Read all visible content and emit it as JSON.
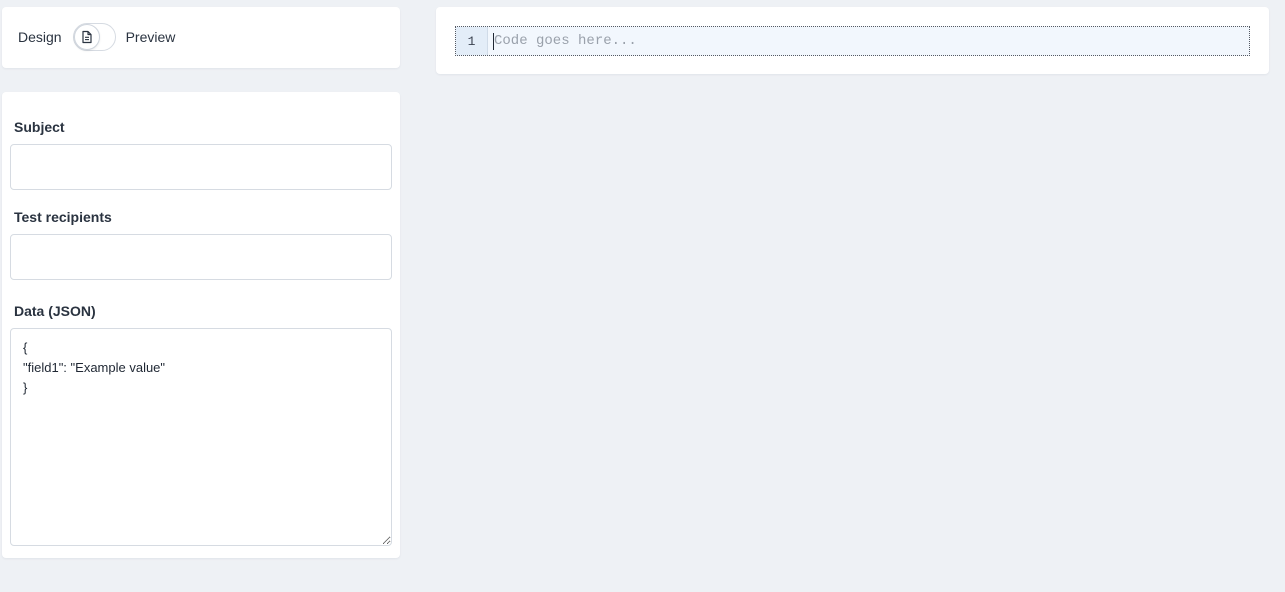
{
  "mode": {
    "design_label": "Design",
    "preview_label": "Preview",
    "toggle_icon": "document-icon"
  },
  "form": {
    "subject_label": "Subject",
    "subject_value": "",
    "recipients_label": "Test recipients",
    "recipients_value": "",
    "data_label": "Data (JSON)",
    "data_value": "{\n\"field1\": \"Example value\"\n}"
  },
  "editor": {
    "line_number": "1",
    "placeholder": "Code goes here..."
  }
}
